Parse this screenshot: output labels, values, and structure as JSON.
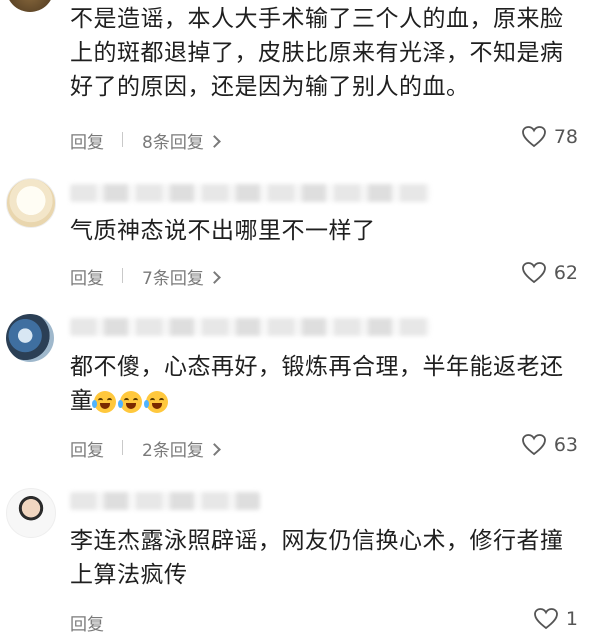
{
  "comments": [
    {
      "text": "不是造谣，本人大手术输了三个人的血，原来脸上的斑都退掉了，皮肤比原来有光泽，不知是病好了的原因，还是因为输了别人的血。",
      "reply_label": "回复",
      "replies_label": "8条回复",
      "likes": "78"
    },
    {
      "text": "气质神态说不出哪里不一样了",
      "reply_label": "回复",
      "replies_label": "7条回复",
      "likes": "62"
    },
    {
      "text": "都不傻，心态再好，锻炼再合理，半年能返老还童",
      "reply_label": "回复",
      "replies_label": "2条回复",
      "likes": "63"
    },
    {
      "text": "李连杰露泳照辟谣，网友仍信换心术，修行者撞上算法疯传",
      "reply_label": "回复",
      "likes": "1"
    }
  ],
  "icons": {
    "like": "heart-outline-icon",
    "more": "chevron-right-icon",
    "emoji": "laughing-tears-emoji"
  }
}
